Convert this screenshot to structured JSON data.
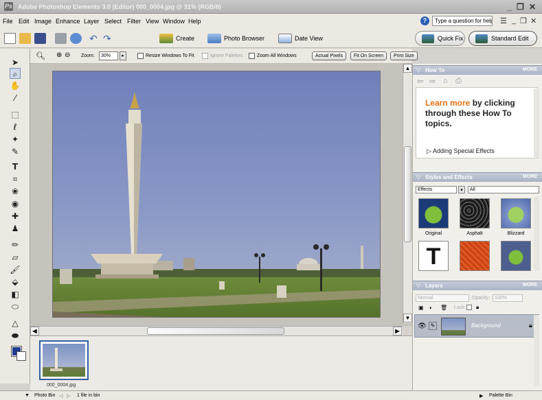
{
  "window": {
    "title": "Adobe Photoshop Elements 3.0 (Editor) 000_0004.jpg @ 31% (RGB/8)",
    "controls": [
      "_",
      "❐",
      "✕"
    ]
  },
  "menubar": {
    "items": [
      "File",
      "Edit",
      "Image",
      "Enhance",
      "Layer",
      "Select",
      "Filter",
      "View",
      "Window",
      "Help"
    ],
    "help_placeholder": "Type a question for help",
    "mdi_controls": [
      "_",
      "❐",
      "✕"
    ]
  },
  "shortcuts": {
    "create_label": "Create",
    "photo_browser_label": "Photo Browser",
    "date_view_label": "Date View",
    "quick_fix_label": "Quick Fix",
    "standard_edit_label": "Standard Edit"
  },
  "options": {
    "zoom_label": "Zoom:",
    "zoom_value": "30%",
    "resize_windows": "Resize Windows To Fit",
    "ignore_palettes": "Ignore Palettes",
    "zoom_all": "Zoom All Windows",
    "actual_pixels": "Actual Pixels",
    "fit_on_screen": "Fit On Screen",
    "print_size": "Print Size"
  },
  "colors": {
    "foreground": "#1f3d8f",
    "background": "#ffffff",
    "accent": "#e5731a",
    "palette_header": "#a9b3c4"
  },
  "photo_bin": {
    "thumb_label": "000_0004.jpg"
  },
  "statusbar": {
    "photo_bin": "Photo Bin",
    "count": "1 file in bin",
    "palette_bin": "Palette Bin"
  },
  "palettes": {
    "howto": {
      "title": "How To",
      "more": "MORE",
      "learn_more": "Learn more",
      "body": " by clicking through these How To topics.",
      "link": "Adding Special Effects"
    },
    "styles": {
      "title": "Styles and Effects",
      "more": "MORE",
      "category": "Effects",
      "filter": "All",
      "items": [
        "Original",
        "Asphalt",
        "Blizzard"
      ]
    },
    "layers": {
      "title": "Layers",
      "more": "MORE",
      "mode": "Normal",
      "opacity_label": "Opacity:",
      "opacity_value": "100%",
      "lock_label": "Lock:",
      "layer_name": "Background"
    }
  }
}
